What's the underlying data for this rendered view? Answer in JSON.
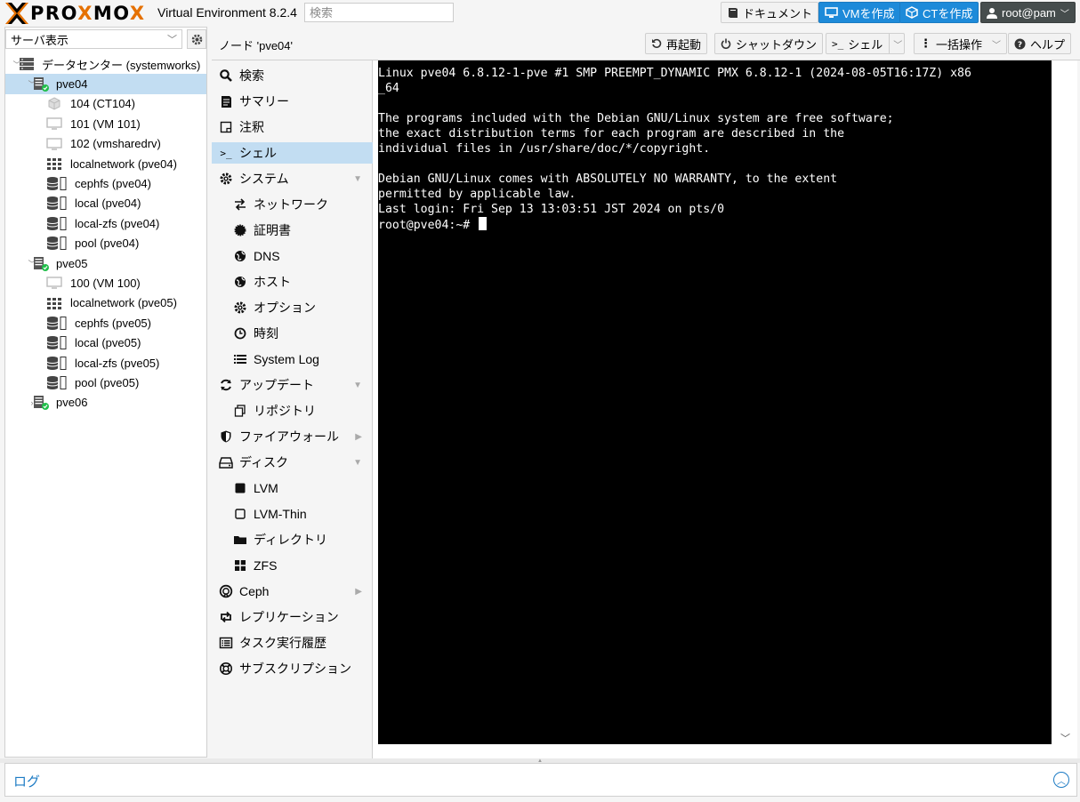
{
  "header": {
    "brand": "PROXMOX",
    "product": "Virtual Environment 8.2.4",
    "search_placeholder": "検索",
    "docs_label": "ドキュメント",
    "create_vm_label": "VMを作成",
    "create_ct_label": "CTを作成",
    "user_label": "root@pam"
  },
  "tree_panel": {
    "view_selected": "サーバ表示",
    "items": [
      {
        "label": "データセンター (systemworks)",
        "icon": "datacenter-icon",
        "level": 0,
        "expand": "v"
      },
      {
        "label": "pve04",
        "icon": "node-online-icon",
        "level": 1,
        "expand": "v",
        "selected": true
      },
      {
        "label": "104 (CT104)",
        "icon": "container-icon",
        "level": 2
      },
      {
        "label": "101 (VM 101)",
        "icon": "vm-icon",
        "level": 2
      },
      {
        "label": "102 (vmsharedrv)",
        "icon": "vm-icon",
        "level": 2
      },
      {
        "label": "localnetwork (pve04)",
        "icon": "network-icon",
        "level": 2
      },
      {
        "label": "cephfs (pve04)",
        "icon": "storage-icon",
        "level": 2
      },
      {
        "label": "local (pve04)",
        "icon": "storage-icon",
        "level": 2
      },
      {
        "label": "local-zfs (pve04)",
        "icon": "storage-icon",
        "level": 2
      },
      {
        "label": "pool (pve04)",
        "icon": "storage-icon",
        "level": 2
      },
      {
        "label": "pve05",
        "icon": "node-online-icon",
        "level": 1,
        "expand": "v"
      },
      {
        "label": "100 (VM 100)",
        "icon": "vm-icon",
        "level": 2
      },
      {
        "label": "localnetwork (pve05)",
        "icon": "network-icon",
        "level": 2
      },
      {
        "label": "cephfs (pve05)",
        "icon": "storage-icon",
        "level": 2
      },
      {
        "label": "local (pve05)",
        "icon": "storage-icon",
        "level": 2
      },
      {
        "label": "local-zfs (pve05)",
        "icon": "storage-icon",
        "level": 2
      },
      {
        "label": "pool (pve05)",
        "icon": "storage-icon",
        "level": 2
      },
      {
        "label": "pve06",
        "icon": "node-online-icon",
        "level": 1,
        "expand": ">"
      }
    ]
  },
  "main": {
    "title": "ノード 'pve04'",
    "toolbar": {
      "reboot_label": "再起動",
      "shutdown_label": "シャットダウン",
      "shell_label": "シェル",
      "bulk_label": "一括操作",
      "help_label": "ヘルプ"
    }
  },
  "nav": {
    "items": [
      {
        "label": "検索",
        "icon": "search-icon",
        "indent": 0
      },
      {
        "label": "サマリー",
        "icon": "summary-icon",
        "indent": 0
      },
      {
        "label": "注釈",
        "icon": "notes-icon",
        "indent": 0
      },
      {
        "label": "シェル",
        "icon": "terminal-icon",
        "indent": 0,
        "selected": true
      },
      {
        "label": "システム",
        "icon": "gear-icon",
        "indent": 0,
        "caret": "down"
      },
      {
        "label": "ネットワーク",
        "icon": "network-exchange-icon",
        "indent": 1
      },
      {
        "label": "証明書",
        "icon": "certificate-icon",
        "indent": 1
      },
      {
        "label": "DNS",
        "icon": "globe-icon",
        "indent": 1
      },
      {
        "label": "ホスト",
        "icon": "globe-icon",
        "indent": 1
      },
      {
        "label": "オプション",
        "icon": "gear-icon",
        "indent": 1
      },
      {
        "label": "時刻",
        "icon": "clock-icon",
        "indent": 1
      },
      {
        "label": "System Log",
        "icon": "list-icon",
        "indent": 1
      },
      {
        "label": "アップデート",
        "icon": "refresh-icon",
        "indent": 0,
        "caret": "down"
      },
      {
        "label": "リポジトリ",
        "icon": "copy-icon",
        "indent": 1
      },
      {
        "label": "ファイアウォール",
        "icon": "shield-icon",
        "indent": 0,
        "caret": "right"
      },
      {
        "label": "ディスク",
        "icon": "hdd-icon",
        "indent": 0,
        "caret": "down"
      },
      {
        "label": "LVM",
        "icon": "square-filled-icon",
        "indent": 1
      },
      {
        "label": "LVM-Thin",
        "icon": "square-outline-icon",
        "indent": 1
      },
      {
        "label": "ディレクトリ",
        "icon": "folder-icon",
        "indent": 1
      },
      {
        "label": "ZFS",
        "icon": "grid-icon",
        "indent": 1
      },
      {
        "label": "Ceph",
        "icon": "ceph-icon",
        "indent": 0,
        "caret": "right"
      },
      {
        "label": "レプリケーション",
        "icon": "retweet-icon",
        "indent": 0
      },
      {
        "label": "タスク実行履歴",
        "icon": "task-list-icon",
        "indent": 0
      },
      {
        "label": "サブスクリプション",
        "icon": "support-icon",
        "indent": 0
      }
    ]
  },
  "terminal": {
    "lines": [
      "Linux pve04 6.8.12-1-pve #1 SMP PREEMPT_DYNAMIC PMX 6.8.12-1 (2024-08-05T16:17Z) x86",
      "_64",
      "",
      "The programs included with the Debian GNU/Linux system are free software;",
      "the exact distribution terms for each program are described in the",
      "individual files in /usr/share/doc/*/copyright.",
      "",
      "Debian GNU/Linux comes with ABSOLUTELY NO WARRANTY, to the extent",
      "permitted by applicable law.",
      "Last login: Fri Sep 13 13:03:51 JST 2024 on pts/0"
    ],
    "prompt": "root@pve04:~# "
  },
  "log": {
    "title": "ログ"
  },
  "colors": {
    "accent": "#1d8ad9",
    "brand_orange": "#e57000",
    "selected": "#c2ddf2",
    "online": "#21bf4b"
  }
}
